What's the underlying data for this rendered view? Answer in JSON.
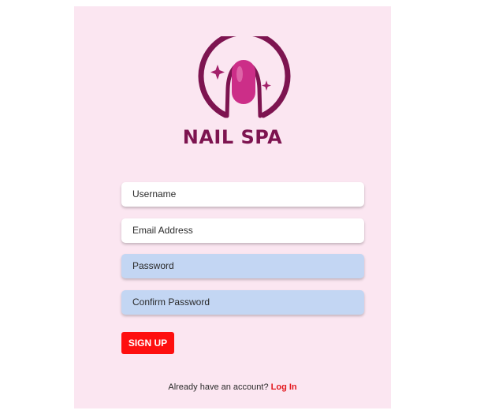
{
  "brand": {
    "name": "NAIL SPA",
    "logo_icon": "nail-hand-icon",
    "colors": {
      "logo_dark": "#7d1450",
      "nail_pink": "#cc2e88",
      "card_bg": "#fbe6f1"
    }
  },
  "form": {
    "username": {
      "placeholder": "Username",
      "value": ""
    },
    "email": {
      "placeholder": "Email Address",
      "value": ""
    },
    "password": {
      "placeholder": "Password",
      "value": ""
    },
    "confirm_password": {
      "placeholder": "Confirm Password",
      "value": ""
    }
  },
  "actions": {
    "signup_label": "SIGN UP",
    "signup_color": "#fe0f0f"
  },
  "footer": {
    "prompt": "Already have an account?",
    "login_label": "Log In",
    "login_color": "#e3171d"
  }
}
